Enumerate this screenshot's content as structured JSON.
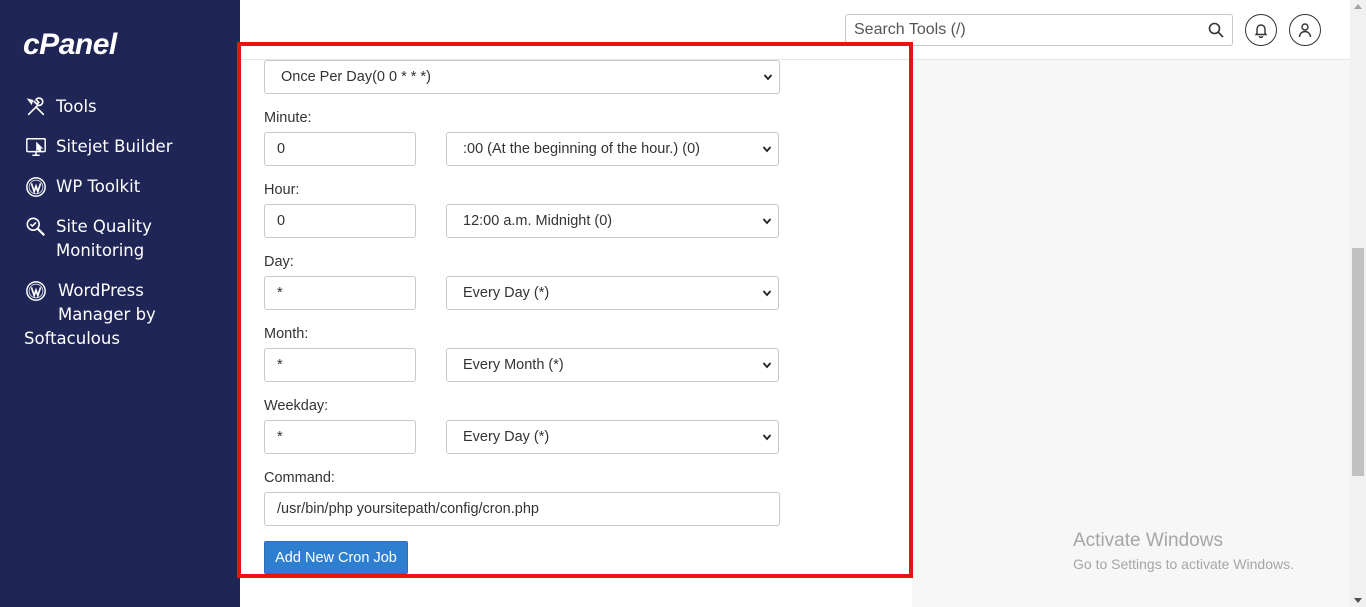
{
  "app": {
    "logo_text": "cPanel"
  },
  "sidebar": {
    "items": [
      {
        "label": "Tools",
        "icon": "tools-icon"
      },
      {
        "label": "Sitejet Builder",
        "icon": "sitejet-icon"
      },
      {
        "label": "WP Toolkit",
        "icon": "wordpress-icon"
      },
      {
        "label_line1": "Site Quality",
        "label_line2": "Monitoring",
        "icon": "site-quality-icon"
      },
      {
        "label_line1": "WordPress",
        "label_line2": "Manager by",
        "label_line3": "Softaculous",
        "icon": "wordpress-icon"
      }
    ]
  },
  "header": {
    "search": {
      "placeholder": "Search Tools (/)",
      "icon": "search-icon"
    },
    "notifications_icon": "bell-icon",
    "user_icon": "user-icon"
  },
  "form": {
    "common_settings": {
      "selected": "Once Per Day(0 0 * * *)"
    },
    "minute": {
      "label": "Minute:",
      "value": "0",
      "selected": ":00 (At the beginning of the hour.) (0)"
    },
    "hour": {
      "label": "Hour:",
      "value": "0",
      "selected": "12:00 a.m. Midnight (0)"
    },
    "day": {
      "label": "Day:",
      "value": "*",
      "selected": "Every Day (*)"
    },
    "month": {
      "label": "Month:",
      "value": "*",
      "selected": "Every Month (*)"
    },
    "weekday": {
      "label": "Weekday:",
      "value": "*",
      "selected": "Every Day (*)"
    },
    "command": {
      "label": "Command:",
      "value": "/usr/bin/php  yoursitepath/config/cron.php"
    },
    "submit_label": "Add New Cron Job"
  },
  "watermark": {
    "title": "Activate Windows",
    "subtitle": "Go to Settings to activate Windows."
  },
  "colors": {
    "sidebar_bg": "#1f2656",
    "primary_button": "#2f7fd1",
    "highlight_frame": "#ee1111"
  }
}
